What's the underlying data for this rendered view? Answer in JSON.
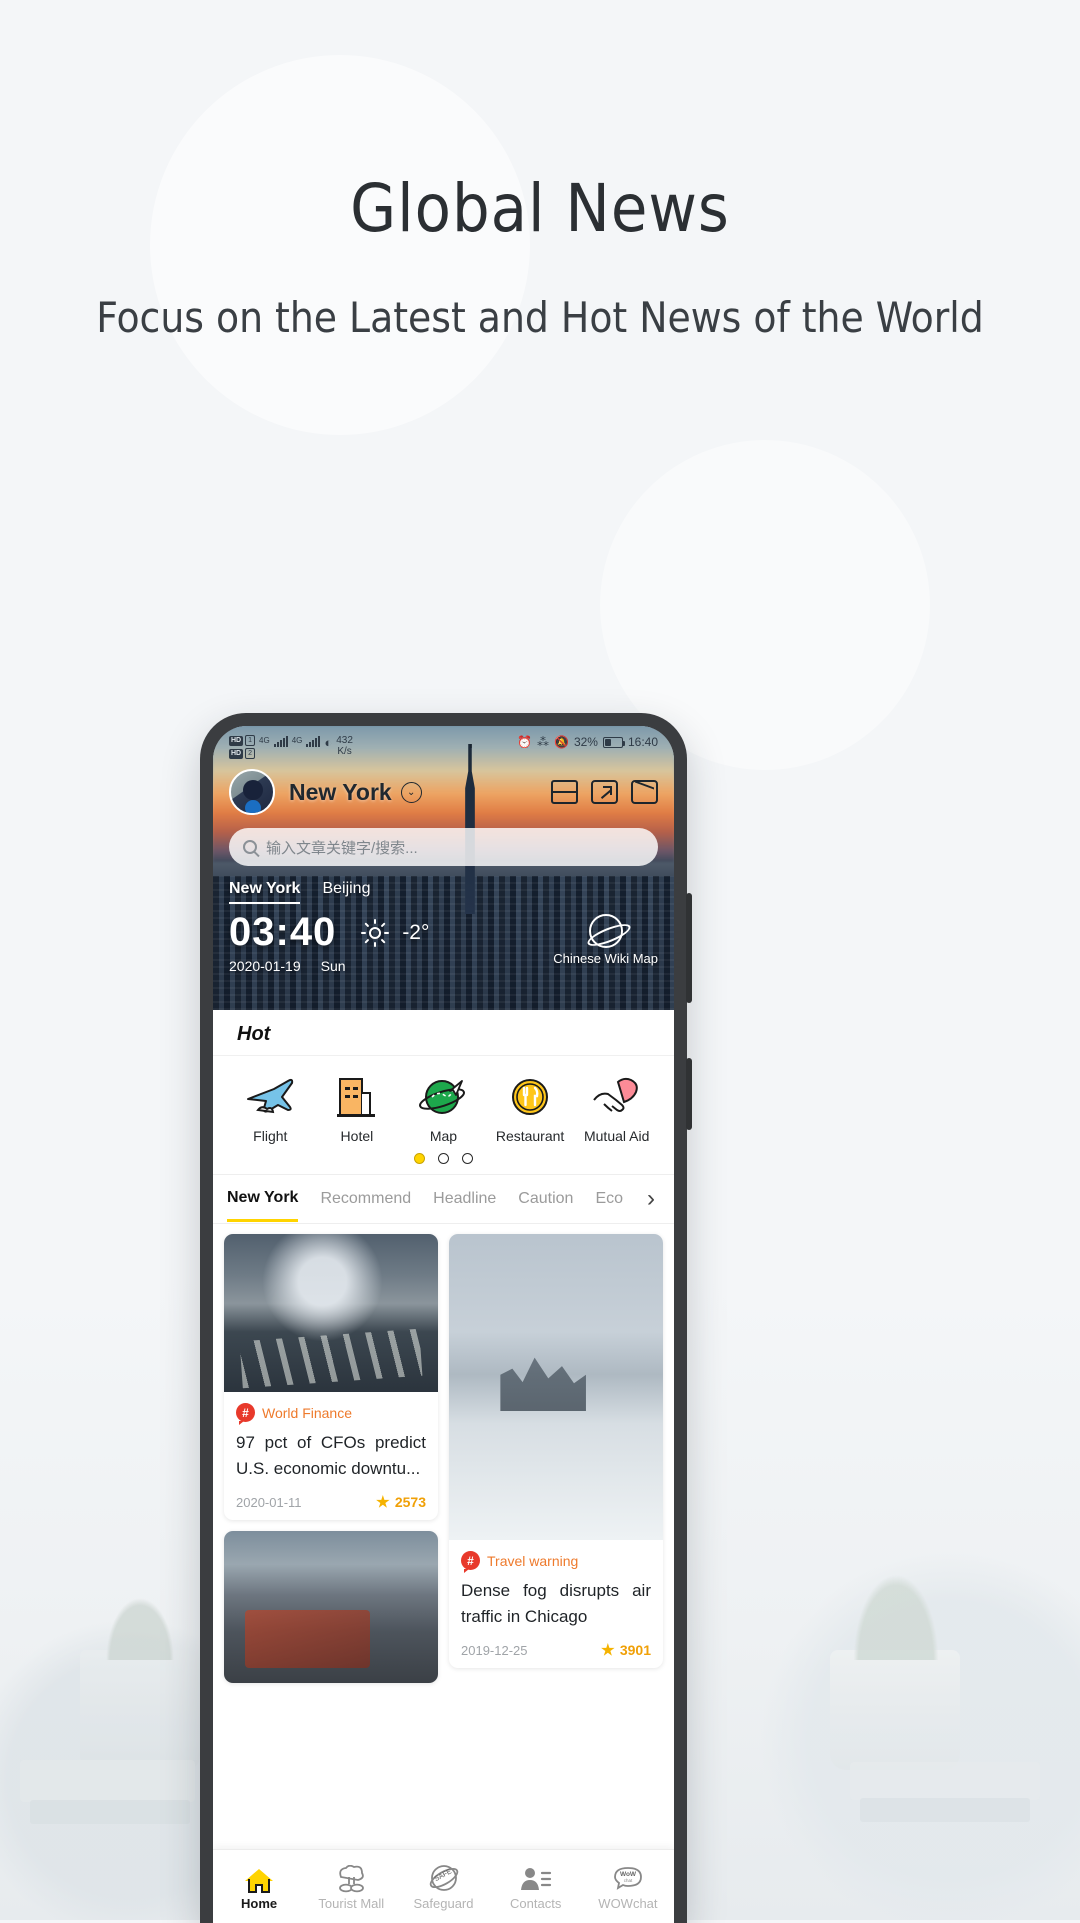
{
  "page": {
    "title": "Global News",
    "subtitle": "Focus on the Latest and Hot News of the World"
  },
  "statusbar": {
    "hd1": "HD",
    "hd2": "HD",
    "sim1": "1",
    "sim2": "2",
    "net1": "4G",
    "net2": "4G",
    "speed_value": "432",
    "speed_unit": "K/s",
    "alarm_icon": "alarm-icon",
    "bluetooth_icon": "bluetooth-icon",
    "mute_icon": "mute-bell-icon",
    "battery_pct": "32%",
    "clock": "16:40"
  },
  "header": {
    "city": "New York",
    "chevron": "⌄",
    "icons": [
      "scan-icon",
      "share-icon",
      "mail-icon"
    ]
  },
  "search": {
    "placeholder": "输入文章关键字/搜索..."
  },
  "weather": {
    "tabs": [
      {
        "label": "New York",
        "active": true
      },
      {
        "label": "Beijing",
        "active": false
      }
    ],
    "time": "03:40",
    "temp": "-2°",
    "date": "2020-01-19",
    "weekday": "Sun",
    "wiki_label": "Chinese Wiki Map"
  },
  "hot": {
    "label": "Hot",
    "highlight_color": "#ffe23d",
    "items": [
      {
        "label": "Flight",
        "icon": "airplane-icon"
      },
      {
        "label": "Hotel",
        "icon": "hotel-building-icon"
      },
      {
        "label": "Map",
        "icon": "globe-map-icon"
      },
      {
        "label": "Restaurant",
        "icon": "fork-knife-icon"
      },
      {
        "label": "Mutual Aid",
        "icon": "handshake-icon"
      }
    ],
    "dots": [
      true,
      false,
      false
    ]
  },
  "news_tabs": [
    {
      "label": "New York",
      "active": true
    },
    {
      "label": "Recommend",
      "active": false
    },
    {
      "label": "Headline",
      "active": false
    },
    {
      "label": "Caution",
      "active": false
    },
    {
      "label": "Eco",
      "active": false
    }
  ],
  "news_tabs_more": "›",
  "cards": {
    "left": [
      {
        "image": "money-tornado-city-photo",
        "category": "World Finance",
        "title": "97 pct of CFOs predict U.S. economic downtu...",
        "date": "2020-01-11",
        "stars": "2573"
      },
      {
        "image": "street-scene-photo",
        "category": "",
        "title": "",
        "date": "",
        "stars": ""
      }
    ],
    "right": [
      {
        "image": "foggy-skyline-photo",
        "category": "Travel warning",
        "title": "Dense fog disrupts air traffic in Chicago",
        "date": "2019-12-25",
        "stars": "3901"
      }
    ]
  },
  "bottom_nav": [
    {
      "label": "Home",
      "icon": "home-icon",
      "active": true
    },
    {
      "label": "Tourist Mall",
      "icon": "tree-icon",
      "active": false
    },
    {
      "label": "Safeguard",
      "icon": "safe-globe-icon",
      "active": false
    },
    {
      "label": "Contacts",
      "icon": "contacts-icon",
      "active": false
    },
    {
      "label": "WOWchat",
      "icon": "wow-chat-icon",
      "active": false
    }
  ],
  "colors": {
    "accent_yellow": "#ffd400",
    "category_orange": "#ee7a2c",
    "hash_red": "#e8392b",
    "star_gold": "#f5b301"
  }
}
